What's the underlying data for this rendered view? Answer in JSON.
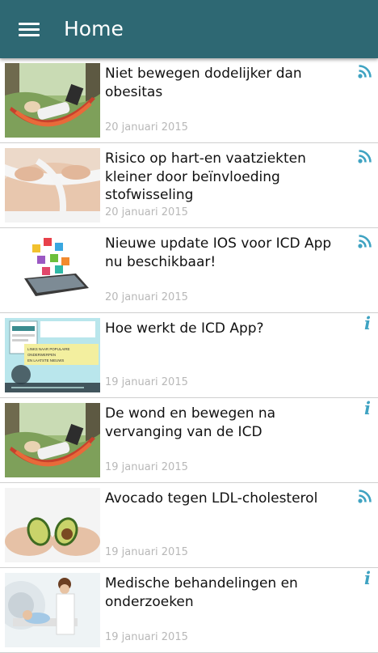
{
  "header": {
    "title": "Home",
    "menu_icon": "hamburger-menu-icon",
    "background": "#2e6873"
  },
  "colors": {
    "accent": "#3fa3c2",
    "date_text": "#b8b8b8"
  },
  "articles": [
    {
      "title": "Niet bewegen dodelijker dan obesitas",
      "date": "20 januari 2015",
      "type_icon": "rss-feed-icon",
      "thumbnail": "hammock-photo"
    },
    {
      "title": "Risico op hart-en vaatziekten kleiner door beïnvloeding stofwisseling",
      "date": "20 januari 2015",
      "type_icon": "rss-feed-icon",
      "thumbnail": "measuring-tape-photo"
    },
    {
      "title": "Nieuwe update IOS voor ICD App nu beschikbaar!",
      "date": "20 januari 2015",
      "type_icon": "rss-feed-icon",
      "thumbnail": "smartphone-apps-photo"
    },
    {
      "title": "Hoe werkt de ICD App?",
      "date": "19 januari 2015",
      "type_icon": "info-icon",
      "thumbnail": "video-screenshot"
    },
    {
      "title": "De wond en bewegen na vervanging van de ICD",
      "date": "19 januari 2015",
      "type_icon": "info-icon",
      "thumbnail": "hammock-photo"
    },
    {
      "title": "Avocado tegen LDL-cholesterol",
      "date": "19 januari 2015",
      "type_icon": "rss-feed-icon",
      "thumbnail": "avocado-photo"
    },
    {
      "title": "Medische behandelingen en onderzoeken",
      "date": "19 januari 2015",
      "type_icon": "info-icon",
      "thumbnail": "medical-scan-photo"
    }
  ],
  "video_thumbnail_text": [
    "LINKS NAAR POPULAIRE",
    "ONDERWERPEN",
    "EN LAATSTE NIEUWS"
  ]
}
